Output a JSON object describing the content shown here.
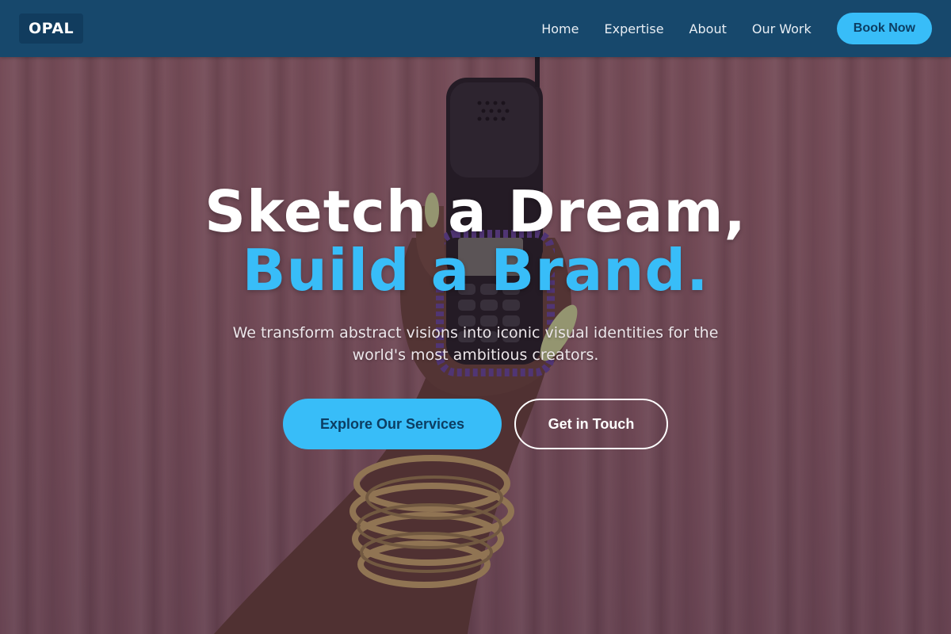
{
  "nav": {
    "logo": "OPAL",
    "links": [
      "Home",
      "Expertise",
      "About",
      "Our Work"
    ],
    "cta": "Book Now"
  },
  "hero": {
    "headline_line1": "Sketch a Dream,",
    "headline_line2": "Build a Brand.",
    "subtitle": "We transform abstract visions into iconic visual identities for the world's most ambitious creators.",
    "primary_cta": "Explore Our Services",
    "secondary_cta": "Get in Touch"
  },
  "colors": {
    "nav_bg": "#17486c",
    "accent": "#38bdf8",
    "accent_text": "#0c3e63",
    "white": "#ffffff"
  }
}
